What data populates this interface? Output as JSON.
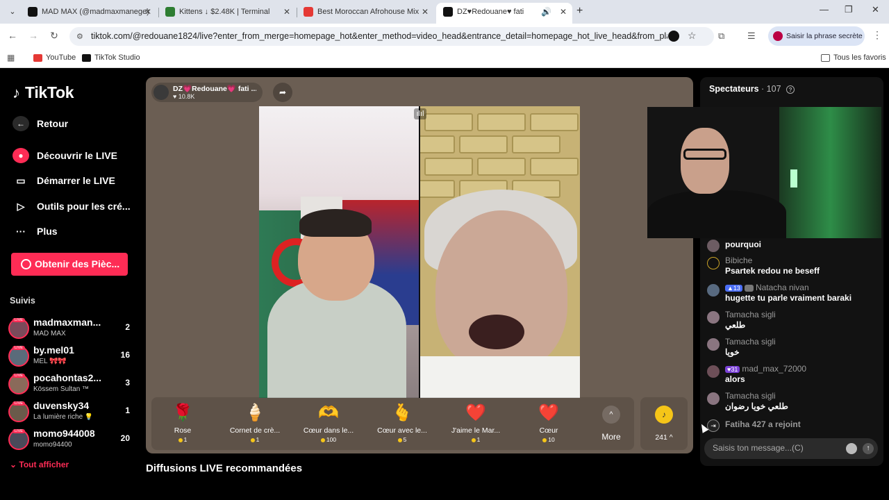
{
  "browser": {
    "tabs": [
      {
        "label": "MAD MAX (@madmaxmanege)",
        "color": "#111111"
      },
      {
        "label": "Kittens ↓ $2.48K | Terminal",
        "color": "#2e7d32"
      },
      {
        "label": "Best Moroccan Afrohouse Mix",
        "color": "#e53935"
      },
      {
        "label": "DZ♥Redouane♥ fati",
        "color": "#111111"
      }
    ],
    "url": "tiktok.com/@redouane1824/live?enter_from_merge=homepage_hot&enter_method=video_head&entrance_detail=homepage_hot_live_head&from_play_mod...",
    "profile_label": "Saisir la phrase secrète",
    "bookmarks": [
      "YouTube",
      "TikTok Studio"
    ],
    "all_bookmarks": "Tous les favoris"
  },
  "sidebar": {
    "logo": "TikTok",
    "back": "Retour",
    "items": [
      "Découvrir le LIVE",
      "Démarrer le LIVE",
      "Outils pour les cré...",
      "Plus"
    ],
    "coins_button": "Obtenir des Pièc...",
    "following_title": "Suivis",
    "following": [
      {
        "name": "madmaxman...",
        "sub": "MAD MAX",
        "count": "2",
        "color": "#7a4a5a"
      },
      {
        "name": "by.mel01",
        "sub": "MEL 🎀🎀",
        "count": "16",
        "color": "#5a6b7a"
      },
      {
        "name": "pocahontas2...",
        "sub": "Kössem Sultan ™",
        "count": "3",
        "color": "#8a6a5a"
      },
      {
        "name": "duvensky34",
        "sub": "La lumière riche 💡",
        "count": "1",
        "color": "#6a5a4a"
      },
      {
        "name": "momo944008",
        "sub": "momo94400",
        "count": "20",
        "color": "#4a4a5a"
      }
    ],
    "show_all": "Tout afficher"
  },
  "live": {
    "host_name": "DZ💗Redouane💗 fati ...",
    "host_likes": "10.8K",
    "gifts": [
      {
        "name": "Rose",
        "price": "1",
        "icon": "🌹"
      },
      {
        "name": "Cornet de crè...",
        "price": "1",
        "icon": "🍦"
      },
      {
        "name": "Cœur dans le...",
        "price": "100",
        "icon": "🫶"
      },
      {
        "name": "Cœur avec le...",
        "price": "5",
        "icon": "🫰"
      },
      {
        "name": "J'aime le Mar...",
        "price": "1",
        "icon": "❤️"
      },
      {
        "name": "Cœur",
        "price": "10",
        "icon": "❤️"
      }
    ],
    "more_label": "More",
    "coin_balance": "241 ^",
    "recommended_title": "Diffusions LIVE recommandées"
  },
  "chat": {
    "title": "Spectateurs",
    "viewer_count": "· 107",
    "messages": [
      {
        "user": "",
        "text": "pourquoi",
        "level": "",
        "level_style": ""
      },
      {
        "user": "Bibiche",
        "text": "Psartek redou ne beseff",
        "level": "",
        "level_style": ""
      },
      {
        "user": "Natacha nivan",
        "text": "hugette tu parle vraiment baraki",
        "level": "13",
        "level_style": "blue"
      },
      {
        "user": "Tamacha sigli",
        "text": "طلعي",
        "level": "",
        "level_style": ""
      },
      {
        "user": "Tamacha sigli",
        "text": "خويا",
        "level": "",
        "level_style": ""
      },
      {
        "user": "mad_max_72000",
        "text": "alors",
        "level": "31",
        "level_style": "purple"
      },
      {
        "user": "Tamacha sigli",
        "text": "طلعي خويا رضوان",
        "level": "",
        "level_style": ""
      }
    ],
    "join_notice": "Fatiha 427 a rejoint",
    "input_placeholder": "Saisis ton message...(C)"
  }
}
